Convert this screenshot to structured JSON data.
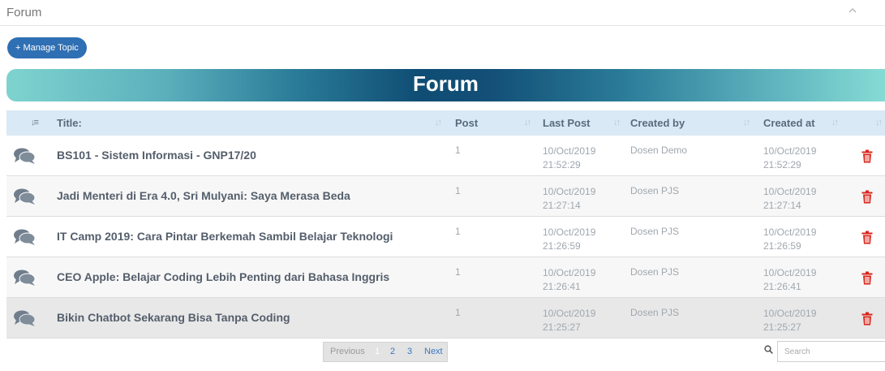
{
  "panel": {
    "title": "Forum"
  },
  "toolbar": {
    "manage_label": "+ Manage Topic"
  },
  "banner": {
    "title": "Forum"
  },
  "table": {
    "columns": [
      "Title:",
      "Post",
      "Last Post",
      "Created by",
      "Created at"
    ],
    "rows": [
      {
        "title": "BS101 - Sistem Informasi - GNP17/20",
        "posts": "1",
        "last_post": "10/Oct/2019\n21:52:29",
        "created_by": "Dosen Demo",
        "created_at": "10/Oct/2019\n21:52:29"
      },
      {
        "title": "Jadi Menteri di Era 4.0, Sri Mulyani: Saya Merasa Beda",
        "posts": "1",
        "last_post": "10/Oct/2019\n21:27:14",
        "created_by": "Dosen PJS",
        "created_at": "10/Oct/2019\n21:27:14"
      },
      {
        "title": "IT Camp 2019: Cara Pintar Berkemah Sambil Belajar Teknologi",
        "posts": "1",
        "last_post": "10/Oct/2019\n21:26:59",
        "created_by": "Dosen PJS",
        "created_at": "10/Oct/2019\n21:26:59"
      },
      {
        "title": "CEO Apple: Belajar Coding Lebih Penting dari Bahasa Inggris",
        "posts": "1",
        "last_post": "10/Oct/2019\n21:26:41",
        "created_by": "Dosen PJS",
        "created_at": "10/Oct/2019\n21:26:41"
      },
      {
        "title": "Bikin Chatbot Sekarang Bisa Tanpa Coding",
        "posts": "1",
        "last_post": "10/Oct/2019\n21:25:27",
        "created_by": "Dosen PJS",
        "created_at": "10/Oct/2019\n21:25:27"
      }
    ]
  },
  "pagination": {
    "previous": "Previous",
    "pages": [
      "1",
      "2",
      "3"
    ],
    "next": "Next",
    "current": "1"
  },
  "search": {
    "placeholder": "Search"
  },
  "icons": {
    "topic": "chat-bubbles-icon",
    "delete": "trash-icon",
    "collapse": "chevron-up-icon",
    "search": "magnifier-icon",
    "sort": "sort-arrows-icon"
  },
  "colors": {
    "primary": "#2f6fb3",
    "delete": "#d9261c",
    "header_bg": "#d9e9f5"
  }
}
